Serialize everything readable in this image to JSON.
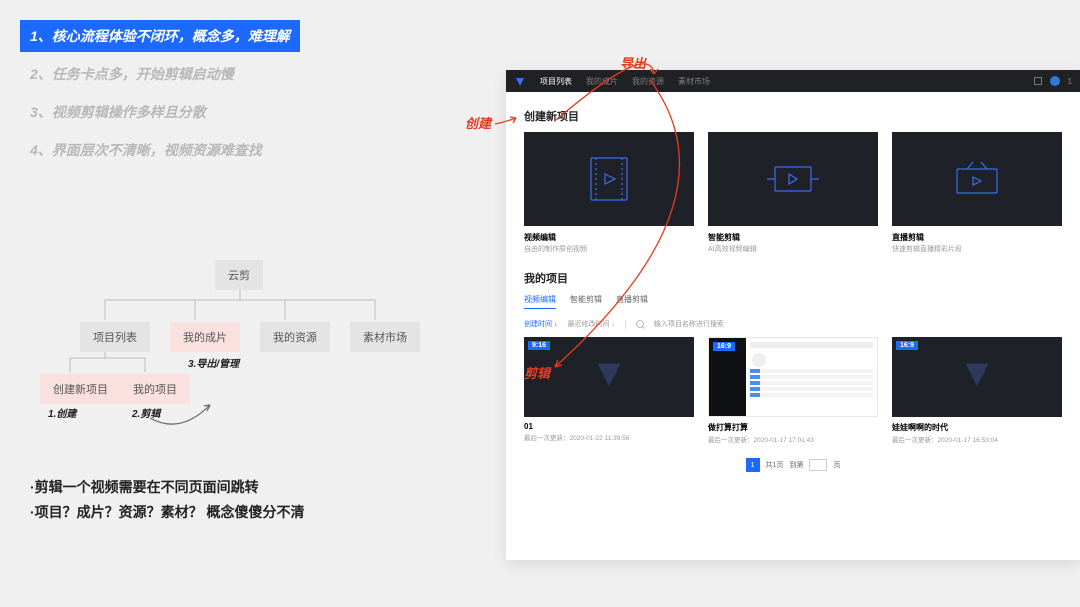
{
  "issues": [
    "1、核心流程体验不闭环，概念多，难理解",
    "2、任务卡点多，开始剪辑启动慢",
    "3、视频剪辑操作多样且分散",
    "4、界面层次不清晰，视频资源难查找"
  ],
  "diagram": {
    "root": "云剪",
    "level2": [
      "项目列表",
      "我的成片",
      "我的资源",
      "素材市场"
    ],
    "level3": [
      "创建新项目",
      "我的项目"
    ],
    "captions": [
      "1.创建",
      "2.剪辑",
      "3.导出/管理"
    ]
  },
  "bullets": [
    "·剪辑一个视频需要在不同页面间跳转",
    "·项目？成片？资源？素材？ 概念傻傻分不清"
  ],
  "annot": {
    "create": "创建",
    "export": "导出",
    "edit": "剪辑"
  },
  "app": {
    "nav": [
      "项目列表",
      "我的成片",
      "我的资源",
      "素材市场"
    ],
    "topUser": "1",
    "create_title": "创建新项目",
    "create_cards": [
      {
        "title": "视频编辑",
        "sub": "自由的制作原创视频"
      },
      {
        "title": "智能剪辑",
        "sub": "AI高效视频编辑"
      },
      {
        "title": "直播剪辑",
        "sub": "快速剪辑直播精彩片段"
      }
    ],
    "my_title": "我的项目",
    "my_tabs": [
      "视频编辑",
      "智能剪辑",
      "直播剪辑"
    ],
    "sort": {
      "active": "创建时间 ↓",
      "other": "最近修改时间 ↓",
      "placeholder": "输入项目名称进行搜索"
    },
    "projects": [
      {
        "badge": "9:16",
        "title": "01",
        "sub": "最后一次更新：2020-01-22 11:39:56"
      },
      {
        "badge": "16:9",
        "title": "做打算打算",
        "sub": "最后一次更新：2020-01-17 17:01:43"
      },
      {
        "badge": "16:9",
        "title": "娃娃啊啊的时代",
        "sub": "最后一次更新：2020-01-17 16:53:04"
      }
    ],
    "pager": {
      "page": "1",
      "text1": "共1页",
      "text2": "到第",
      "text3": "页"
    }
  }
}
